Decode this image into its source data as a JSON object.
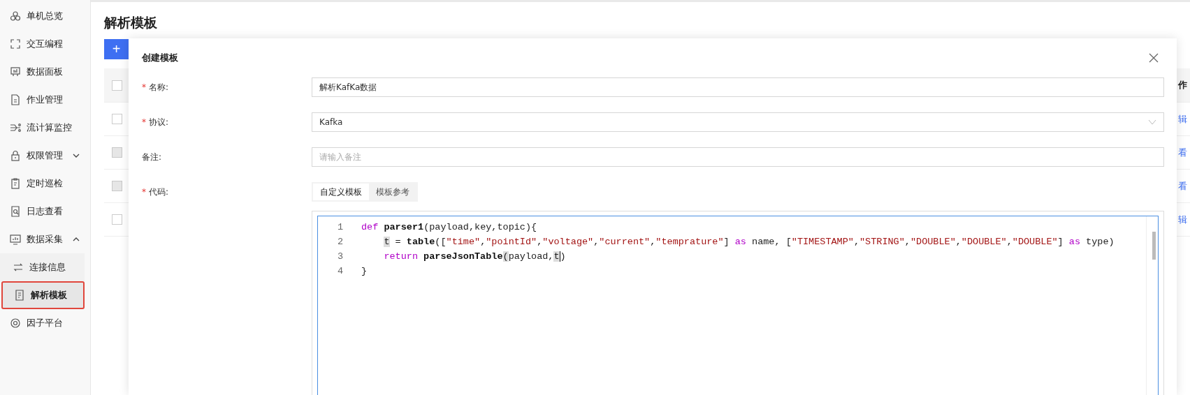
{
  "sidebar": {
    "items": [
      {
        "label": "单机总览",
        "selected": false
      },
      {
        "label": "交互编程",
        "selected": false
      },
      {
        "label": "数据面板",
        "selected": false
      },
      {
        "label": "作业管理",
        "selected": false
      },
      {
        "label": "流计算监控",
        "selected": false
      },
      {
        "label": "权限管理",
        "selected": false,
        "expanded": false
      },
      {
        "label": "定时巡检",
        "selected": false
      },
      {
        "label": "日志查看",
        "selected": false
      },
      {
        "label": "数据采集",
        "selected": false,
        "expanded": true,
        "children": [
          {
            "label": "连接信息",
            "selected": false
          },
          {
            "label": "解析模板",
            "selected": true
          }
        ]
      },
      {
        "label": "因子平台",
        "selected": false
      }
    ]
  },
  "page": {
    "title": "解析模板",
    "add_button": "+",
    "table": {
      "columns": [
        {
          "label": "作"
        }
      ],
      "header_checkbox": {
        "checked": false,
        "disabled": false
      },
      "rows": [
        {
          "checked": false,
          "disabled": false,
          "action": "辑"
        },
        {
          "checked": false,
          "disabled": true,
          "action": "看"
        },
        {
          "checked": false,
          "disabled": true,
          "action": "看"
        },
        {
          "checked": false,
          "disabled": false,
          "action": "辑"
        }
      ]
    }
  },
  "dialog": {
    "title": "创建模板",
    "fields": [
      {
        "kind": "text",
        "label": "名称:",
        "required_mark": "*",
        "value": "解析KafKa数据"
      },
      {
        "kind": "select",
        "label": "协议:",
        "required_mark": "*",
        "value": "Kafka"
      },
      {
        "kind": "text",
        "label": "备注:",
        "placeholder": "请输入备注"
      },
      {
        "kind": "code",
        "label": "代码:",
        "required_mark": "*",
        "tabs": [
          {
            "label": "自定义模板",
            "selected": true
          },
          {
            "label": "模板参考",
            "selected": false
          }
        ],
        "lines": [
          {
            "number": "1",
            "tokens": [
              {
                "kind": "keyword",
                "text": "def "
              },
              {
                "kind": "func",
                "text": "parser1"
              },
              {
                "kind": "plain",
                "text": "(payload,key,topic){"
              }
            ],
            "children": [
              {
                "number": "2",
                "tokens": [
                  {
                    "kind": "match",
                    "text": "t"
                  },
                  {
                    "kind": "plain",
                    "text": " = "
                  },
                  {
                    "kind": "func",
                    "text": "table"
                  },
                  {
                    "kind": "plain",
                    "text": "(["
                  },
                  {
                    "kind": "string",
                    "text": "\"time\""
                  },
                  {
                    "kind": "plain",
                    "text": ","
                  },
                  {
                    "kind": "string",
                    "text": "\"pointId\""
                  },
                  {
                    "kind": "plain",
                    "text": ","
                  },
                  {
                    "kind": "string",
                    "text": "\"voltage\""
                  },
                  {
                    "kind": "plain",
                    "text": ","
                  },
                  {
                    "kind": "string",
                    "text": "\"current\""
                  },
                  {
                    "kind": "plain",
                    "text": ","
                  },
                  {
                    "kind": "string",
                    "text": "\"temprature\""
                  },
                  {
                    "kind": "plain",
                    "text": "] "
                  },
                  {
                    "kind": "keyword",
                    "text": "as"
                  },
                  {
                    "kind": "plain",
                    "text": " name, ["
                  },
                  {
                    "kind": "string",
                    "text": "\"TIMESTAMP\""
                  },
                  {
                    "kind": "plain",
                    "text": ","
                  },
                  {
                    "kind": "string",
                    "text": "\"STRING\""
                  },
                  {
                    "kind": "plain",
                    "text": ","
                  },
                  {
                    "kind": "string",
                    "text": "\"DOUBLE\""
                  },
                  {
                    "kind": "plain",
                    "text": ","
                  },
                  {
                    "kind": "string",
                    "text": "\"DOUBLE\""
                  },
                  {
                    "kind": "plain",
                    "text": ","
                  },
                  {
                    "kind": "string",
                    "text": "\"DOUBLE\""
                  },
                  {
                    "kind": "plain",
                    "text": "] "
                  },
                  {
                    "kind": "keyword",
                    "text": "as"
                  },
                  {
                    "kind": "plain",
                    "text": " type)"
                  }
                ]
              },
              {
                "number": "3",
                "tokens": [
                  {
                    "kind": "keyword",
                    "text": "return "
                  },
                  {
                    "kind": "func",
                    "text": "parseJsonTable"
                  },
                  {
                    "kind": "match",
                    "text": "("
                  },
                  {
                    "kind": "plain",
                    "text": "payload,"
                  },
                  {
                    "kind": "match",
                    "text": "t"
                  },
                  {
                    "kind": "cursor",
                    "text": ")"
                  }
                ]
              }
            ]
          },
          {
            "number": "4",
            "tokens": [
              {
                "kind": "plain",
                "text": "}"
              }
            ]
          }
        ]
      }
    ]
  }
}
